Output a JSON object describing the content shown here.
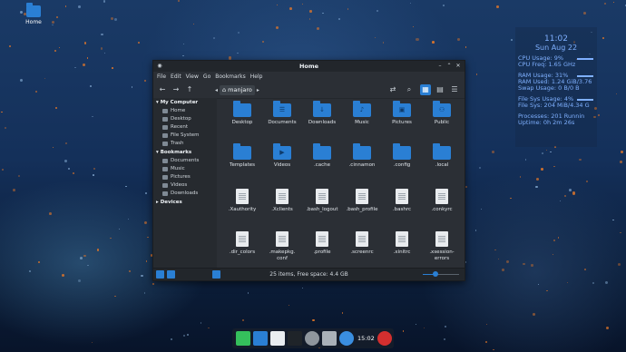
{
  "desktop": {
    "icon_label": "Home"
  },
  "window": {
    "title": "Home",
    "menu": [
      "File",
      "Edit",
      "View",
      "Go",
      "Bookmarks",
      "Help"
    ],
    "path": {
      "current": "manjaro"
    },
    "status": "25 items, Free space: 4.4 GB",
    "zoom_level": 0.35,
    "sidebar": {
      "my_computer": {
        "title": "My Computer",
        "items": [
          "Home",
          "Desktop",
          "Recent",
          "File System",
          "Trash"
        ]
      },
      "bookmarks": {
        "title": "Bookmarks",
        "items": [
          "Documents",
          "Music",
          "Pictures",
          "Videos",
          "Downloads"
        ]
      },
      "devices": {
        "title": "Devices"
      }
    },
    "files": [
      {
        "name": "Desktop",
        "kind": "folder"
      },
      {
        "name": "Documents",
        "kind": "folder"
      },
      {
        "name": "Downloads",
        "kind": "folder"
      },
      {
        "name": "Music",
        "kind": "folder"
      },
      {
        "name": "Pictures",
        "kind": "folder"
      },
      {
        "name": "Public",
        "kind": "folder"
      },
      {
        "name": "Templates",
        "kind": "folder"
      },
      {
        "name": "Videos",
        "kind": "folder"
      },
      {
        "name": ".cache",
        "kind": "folder"
      },
      {
        "name": ".cinnamon",
        "kind": "folder"
      },
      {
        "name": ".config",
        "kind": "folder"
      },
      {
        "name": ".local",
        "kind": "folder"
      },
      {
        "name": ".Xauthority",
        "kind": "file"
      },
      {
        "name": ".Xclients",
        "kind": "file"
      },
      {
        "name": ".bash_logout",
        "kind": "file"
      },
      {
        "name": ".bash_profile",
        "kind": "file"
      },
      {
        "name": ".bashrc",
        "kind": "file"
      },
      {
        "name": ".conkyrc",
        "kind": "file"
      },
      {
        "name": ".dir_colors",
        "kind": "file"
      },
      {
        "name": ".makepkg.\nconf",
        "kind": "file"
      },
      {
        "name": ".profile",
        "kind": "file"
      },
      {
        "name": ".screenrc",
        "kind": "file"
      },
      {
        "name": ".xinitrc",
        "kind": "file"
      },
      {
        "name": ".xsession-\nerrors",
        "kind": "file"
      }
    ]
  },
  "conky": {
    "time": "11:02",
    "date": "Sun Aug 22",
    "cpu_usage": "CPU Usage: 9%",
    "cpu_freq": "CPU Freq: 1.65 GHz",
    "ram_usage": "RAM Usage: 31%",
    "ram_used": "RAM Used: 1.24 GiB/3.76",
    "swap_usage": "Swap Usage: 0 B/0 B",
    "fs_usage": "File Sys Usage: 4%",
    "fs_sys": "File Sys: 204 MiB/4.34 G",
    "processes": "Processes: 201  Runnin",
    "uptime": "Uptime: 0h 2m 26s"
  },
  "dock": {
    "time": "15:02"
  },
  "colors": {
    "accent": "#2a7fd4",
    "conky": "#7fb0ff"
  }
}
